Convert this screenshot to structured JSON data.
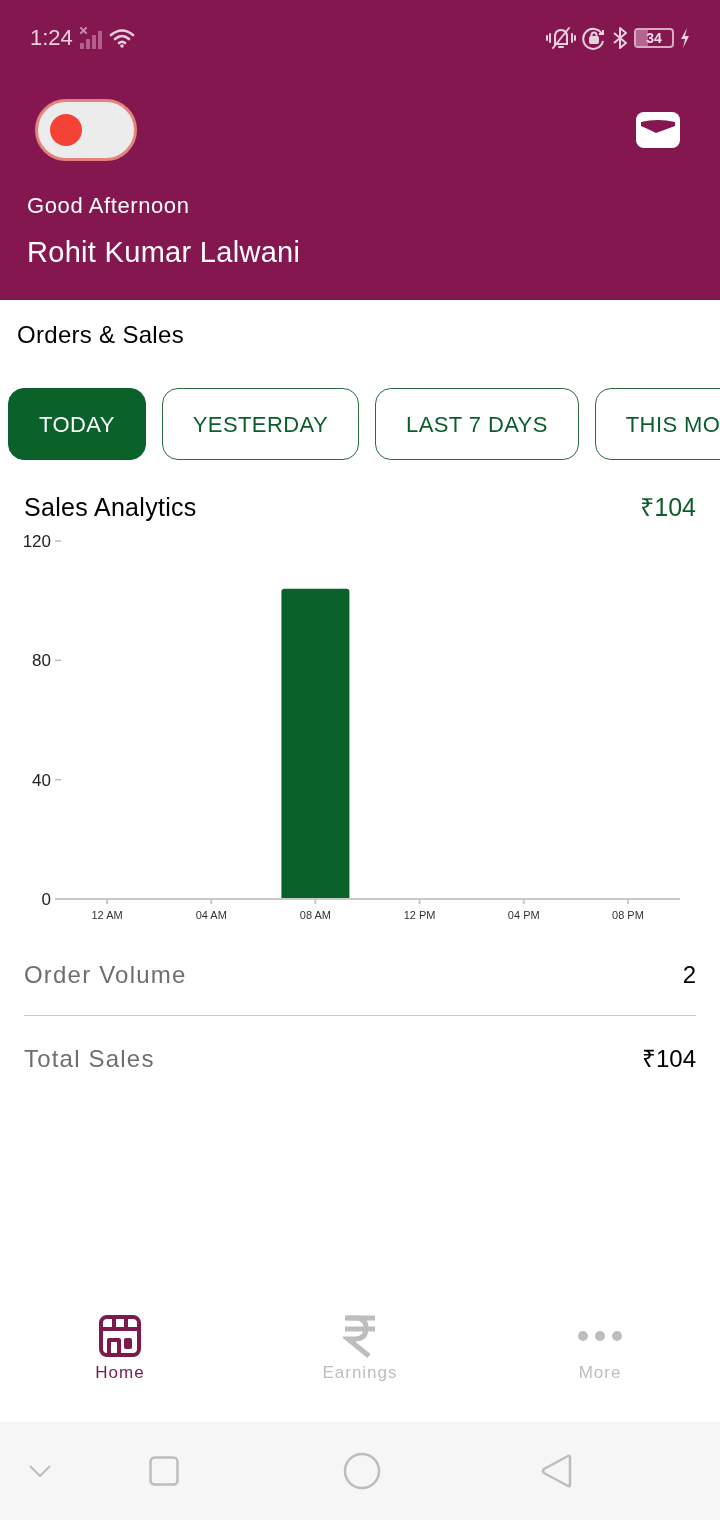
{
  "status_bar": {
    "time": "1:24",
    "battery": "34"
  },
  "header": {
    "online_toggle": {
      "on": false
    },
    "greeting": "Good Afternoon",
    "user_name": "Rohit Kumar Lalwani"
  },
  "orders_sales": {
    "title": "Orders & Sales",
    "tabs": [
      {
        "label": "TODAY",
        "selected": true
      },
      {
        "label": "YESTERDAY",
        "selected": false
      },
      {
        "label": "LAST 7 DAYS",
        "selected": false
      },
      {
        "label": "THIS MO",
        "selected": false
      }
    ]
  },
  "sales_analytics": {
    "title": "Sales Analytics",
    "total": "₹104",
    "chart_data": {
      "type": "bar",
      "categories": [
        "12 AM",
        "04 AM",
        "08 AM",
        "12 PM",
        "04 PM",
        "08 PM"
      ],
      "values": [
        0,
        0,
        104,
        0,
        0,
        0
      ],
      "ylim": [
        0,
        120
      ],
      "yticks": [
        0,
        40,
        80,
        120
      ]
    }
  },
  "summary": [
    {
      "label": "Order Volume",
      "value": "2"
    },
    {
      "label": "Total Sales",
      "value": "₹104"
    }
  ],
  "bottom_nav": [
    {
      "label": "Home",
      "selected": true
    },
    {
      "label": "Earnings",
      "selected": false
    },
    {
      "label": "More",
      "selected": false
    }
  ]
}
